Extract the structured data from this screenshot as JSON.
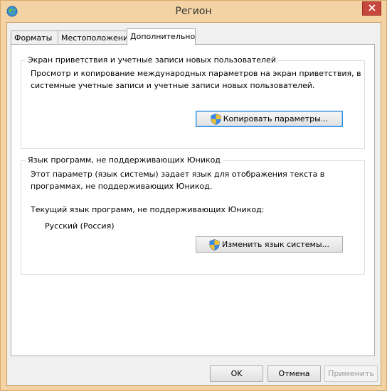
{
  "window": {
    "title": "Регион"
  },
  "tabs": [
    {
      "label": "Форматы"
    },
    {
      "label": "Местоположение"
    },
    {
      "label": "Дополнительно"
    }
  ],
  "group_welcome": {
    "title": "Экран приветствия и учетные записи новых пользователей",
    "text_line1": "Просмотр и копирование международных параметров на экран приветствия, в",
    "text_line2": "системные учетные записи и учетные записи новых пользователей.",
    "button": "Копировать параметры..."
  },
  "group_unicode": {
    "title": "Язык программ, не поддерживающих Юникод",
    "text_line1": "Этот параметр (язык системы) задает язык для отображения текста в",
    "text_line2": "программах, не поддерживающих Юникод.",
    "current_label": "Текущий язык программ, не поддерживающих Юникод:",
    "current_value": "Русский (Россия)",
    "button": "Изменить язык системы..."
  },
  "buttons": {
    "ok": "OK",
    "cancel": "Отмена",
    "apply": "Применить"
  },
  "colors": {
    "frame": "#f3d3a4",
    "close": "#c7463d",
    "focus": "#2f8de0"
  }
}
